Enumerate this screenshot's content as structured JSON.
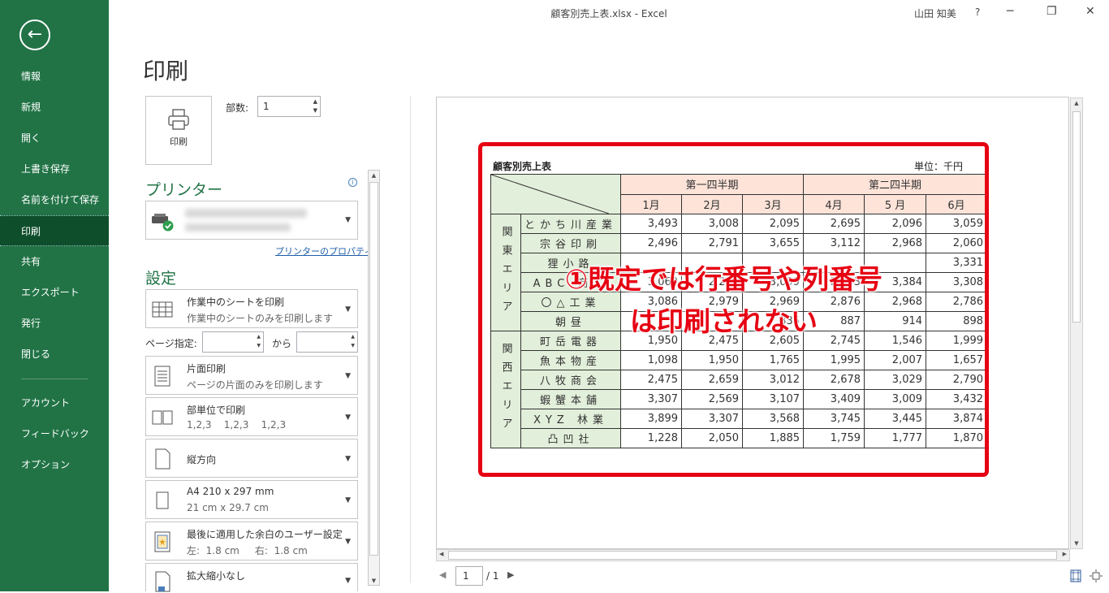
{
  "window": {
    "title": "顧客別売上表.xlsx  -  Excel",
    "user": "山田 知美",
    "help": "?",
    "minimize": "─",
    "restore": "❐",
    "close": "✕"
  },
  "sidebar": {
    "back": "←",
    "items": [
      {
        "label": "情報"
      },
      {
        "label": "新規"
      },
      {
        "label": "開く"
      },
      {
        "label": "上書き保存"
      },
      {
        "label": "名前を付けて保存"
      },
      {
        "label": "印刷"
      },
      {
        "label": "共有"
      },
      {
        "label": "エクスポート"
      },
      {
        "label": "発行"
      },
      {
        "label": "閉じる"
      },
      {
        "label": "アカウント"
      },
      {
        "label": "フィードバック"
      },
      {
        "label": "オプション"
      }
    ],
    "active": "印刷"
  },
  "print": {
    "title": "印刷",
    "button_label": "印刷",
    "copies_label": "部数:",
    "copies_value": "1",
    "printer_section": "プリンター",
    "printer_properties": "プリンターのプロパティ",
    "settings_section": "設定",
    "pages_label": "ページ指定:",
    "pages_to": "から"
  },
  "settings": [
    {
      "main": "作業中のシートを印刷",
      "sub": "作業中のシートのみを印刷します",
      "icon": "sheet-icon"
    },
    {
      "main": "片面印刷",
      "sub": "ページの片面のみを印刷します",
      "icon": "one-sided-icon"
    },
    {
      "main": "部単位で印刷",
      "sub": "1,2,3    1,2,3    1,2,3",
      "icon": "collate-icon"
    },
    {
      "main": "縦方向",
      "sub": "",
      "icon": "portrait-icon"
    },
    {
      "main": "A4 210 x 297 mm",
      "sub": "21 cm x 29.7 cm",
      "icon": "paper-size-icon"
    },
    {
      "main": "最後に適用した余白のユーザー設定",
      "sub": "左:  1.8 cm     右:  1.8 cm",
      "icon": "margins-icon"
    },
    {
      "main": "拡大縮小なし",
      "sub": "",
      "icon": "scaling-icon"
    }
  ],
  "preview": {
    "page_value": "1",
    "page_total": "/ 1",
    "sheet_title": "顧客別売上表",
    "unit": "単位：千円",
    "quarters": [
      "第一四半期",
      "第二四半期"
    ],
    "months": [
      "1月",
      "2月",
      "3月",
      "4月",
      "5 月",
      "6月"
    ],
    "groups": [
      {
        "name": "関東エリア",
        "rows": [
          {
            "customer": "とかち川産業",
            "values": [
              "3,493",
              "3,008",
              "2,095",
              "2,695",
              "2,096",
              "3,059"
            ]
          },
          {
            "customer": "宗谷印刷",
            "values": [
              "2,496",
              "2,791",
              "3,655",
              "3,112",
              "2,968",
              "2,060"
            ]
          },
          {
            "customer": "狸小路",
            "values": [
              "",
              "",
              "",
              "",
              "",
              "3,331"
            ]
          },
          {
            "customer": "ABC 商工",
            "values": [
              "3,069",
              "2,217",
              "3,099",
              "2,793",
              "3,384",
              "3,308"
            ]
          },
          {
            "customer": "〇△工業",
            "values": [
              "3,086",
              "2,979",
              "2,969",
              "2,876",
              "2,968",
              "2,786"
            ]
          },
          {
            "customer": "朝昼",
            "values": [
              "",
              "",
              "335",
              "887",
              "914",
              "898"
            ]
          }
        ]
      },
      {
        "name": "関西エリア",
        "rows": [
          {
            "customer": "町岳電器",
            "values": [
              "1,950",
              "2,475",
              "2,605",
              "2,745",
              "1,546",
              "1,999"
            ]
          },
          {
            "customer": "魚本物産",
            "values": [
              "1,098",
              "1,950",
              "1,765",
              "1,995",
              "2,007",
              "1,657"
            ]
          },
          {
            "customer": "八牧商会",
            "values": [
              "2,475",
              "2,659",
              "3,012",
              "2,678",
              "3,029",
              "2,790"
            ]
          },
          {
            "customer": "蝦蟹本舗",
            "values": [
              "3,307",
              "2,569",
              "3,107",
              "3,409",
              "3,009",
              "3,432"
            ]
          },
          {
            "customer": "XYZ 林業",
            "values": [
              "3,899",
              "3,307",
              "3,568",
              "3,745",
              "3,445",
              "3,874"
            ]
          },
          {
            "customer": "凸凹社",
            "values": [
              "1,228",
              "2,050",
              "1,885",
              "1,759",
              "1,777",
              "1,870"
            ]
          }
        ]
      }
    ],
    "annotation_line1": "①既定では行番号や列番号",
    "annotation_line2": "は印刷されない",
    "accent_color": "#e60012"
  }
}
